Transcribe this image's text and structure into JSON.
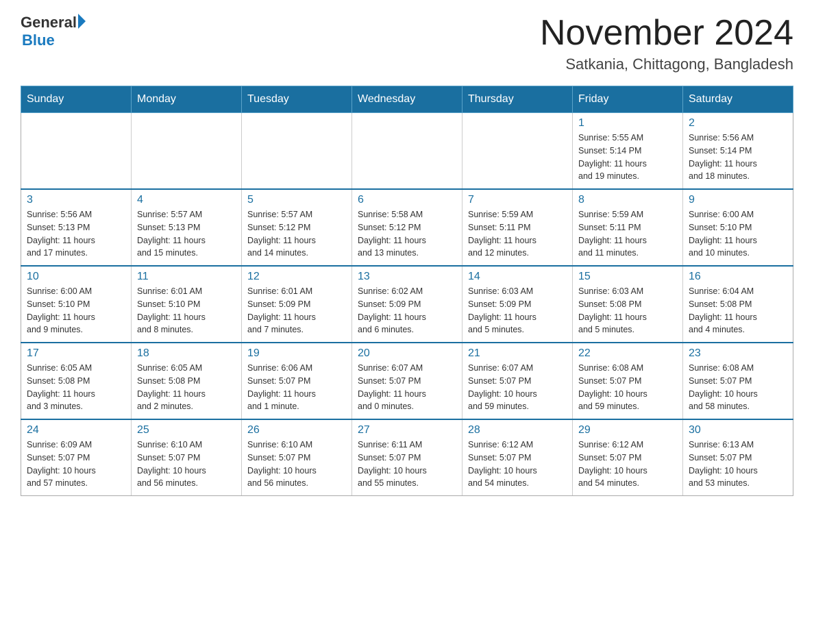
{
  "header": {
    "logo_general": "General",
    "logo_blue": "Blue",
    "title": "November 2024",
    "subtitle": "Satkania, Chittagong, Bangladesh"
  },
  "weekdays": [
    "Sunday",
    "Monday",
    "Tuesday",
    "Wednesday",
    "Thursday",
    "Friday",
    "Saturday"
  ],
  "weeks": [
    [
      {
        "day": "",
        "detail": ""
      },
      {
        "day": "",
        "detail": ""
      },
      {
        "day": "",
        "detail": ""
      },
      {
        "day": "",
        "detail": ""
      },
      {
        "day": "",
        "detail": ""
      },
      {
        "day": "1",
        "detail": "Sunrise: 5:55 AM\nSunset: 5:14 PM\nDaylight: 11 hours\nand 19 minutes."
      },
      {
        "day": "2",
        "detail": "Sunrise: 5:56 AM\nSunset: 5:14 PM\nDaylight: 11 hours\nand 18 minutes."
      }
    ],
    [
      {
        "day": "3",
        "detail": "Sunrise: 5:56 AM\nSunset: 5:13 PM\nDaylight: 11 hours\nand 17 minutes."
      },
      {
        "day": "4",
        "detail": "Sunrise: 5:57 AM\nSunset: 5:13 PM\nDaylight: 11 hours\nand 15 minutes."
      },
      {
        "day": "5",
        "detail": "Sunrise: 5:57 AM\nSunset: 5:12 PM\nDaylight: 11 hours\nand 14 minutes."
      },
      {
        "day": "6",
        "detail": "Sunrise: 5:58 AM\nSunset: 5:12 PM\nDaylight: 11 hours\nand 13 minutes."
      },
      {
        "day": "7",
        "detail": "Sunrise: 5:59 AM\nSunset: 5:11 PM\nDaylight: 11 hours\nand 12 minutes."
      },
      {
        "day": "8",
        "detail": "Sunrise: 5:59 AM\nSunset: 5:11 PM\nDaylight: 11 hours\nand 11 minutes."
      },
      {
        "day": "9",
        "detail": "Sunrise: 6:00 AM\nSunset: 5:10 PM\nDaylight: 11 hours\nand 10 minutes."
      }
    ],
    [
      {
        "day": "10",
        "detail": "Sunrise: 6:00 AM\nSunset: 5:10 PM\nDaylight: 11 hours\nand 9 minutes."
      },
      {
        "day": "11",
        "detail": "Sunrise: 6:01 AM\nSunset: 5:10 PM\nDaylight: 11 hours\nand 8 minutes."
      },
      {
        "day": "12",
        "detail": "Sunrise: 6:01 AM\nSunset: 5:09 PM\nDaylight: 11 hours\nand 7 minutes."
      },
      {
        "day": "13",
        "detail": "Sunrise: 6:02 AM\nSunset: 5:09 PM\nDaylight: 11 hours\nand 6 minutes."
      },
      {
        "day": "14",
        "detail": "Sunrise: 6:03 AM\nSunset: 5:09 PM\nDaylight: 11 hours\nand 5 minutes."
      },
      {
        "day": "15",
        "detail": "Sunrise: 6:03 AM\nSunset: 5:08 PM\nDaylight: 11 hours\nand 5 minutes."
      },
      {
        "day": "16",
        "detail": "Sunrise: 6:04 AM\nSunset: 5:08 PM\nDaylight: 11 hours\nand 4 minutes."
      }
    ],
    [
      {
        "day": "17",
        "detail": "Sunrise: 6:05 AM\nSunset: 5:08 PM\nDaylight: 11 hours\nand 3 minutes."
      },
      {
        "day": "18",
        "detail": "Sunrise: 6:05 AM\nSunset: 5:08 PM\nDaylight: 11 hours\nand 2 minutes."
      },
      {
        "day": "19",
        "detail": "Sunrise: 6:06 AM\nSunset: 5:07 PM\nDaylight: 11 hours\nand 1 minute."
      },
      {
        "day": "20",
        "detail": "Sunrise: 6:07 AM\nSunset: 5:07 PM\nDaylight: 11 hours\nand 0 minutes."
      },
      {
        "day": "21",
        "detail": "Sunrise: 6:07 AM\nSunset: 5:07 PM\nDaylight: 10 hours\nand 59 minutes."
      },
      {
        "day": "22",
        "detail": "Sunrise: 6:08 AM\nSunset: 5:07 PM\nDaylight: 10 hours\nand 59 minutes."
      },
      {
        "day": "23",
        "detail": "Sunrise: 6:08 AM\nSunset: 5:07 PM\nDaylight: 10 hours\nand 58 minutes."
      }
    ],
    [
      {
        "day": "24",
        "detail": "Sunrise: 6:09 AM\nSunset: 5:07 PM\nDaylight: 10 hours\nand 57 minutes."
      },
      {
        "day": "25",
        "detail": "Sunrise: 6:10 AM\nSunset: 5:07 PM\nDaylight: 10 hours\nand 56 minutes."
      },
      {
        "day": "26",
        "detail": "Sunrise: 6:10 AM\nSunset: 5:07 PM\nDaylight: 10 hours\nand 56 minutes."
      },
      {
        "day": "27",
        "detail": "Sunrise: 6:11 AM\nSunset: 5:07 PM\nDaylight: 10 hours\nand 55 minutes."
      },
      {
        "day": "28",
        "detail": "Sunrise: 6:12 AM\nSunset: 5:07 PM\nDaylight: 10 hours\nand 54 minutes."
      },
      {
        "day": "29",
        "detail": "Sunrise: 6:12 AM\nSunset: 5:07 PM\nDaylight: 10 hours\nand 54 minutes."
      },
      {
        "day": "30",
        "detail": "Sunrise: 6:13 AM\nSunset: 5:07 PM\nDaylight: 10 hours\nand 53 minutes."
      }
    ]
  ]
}
